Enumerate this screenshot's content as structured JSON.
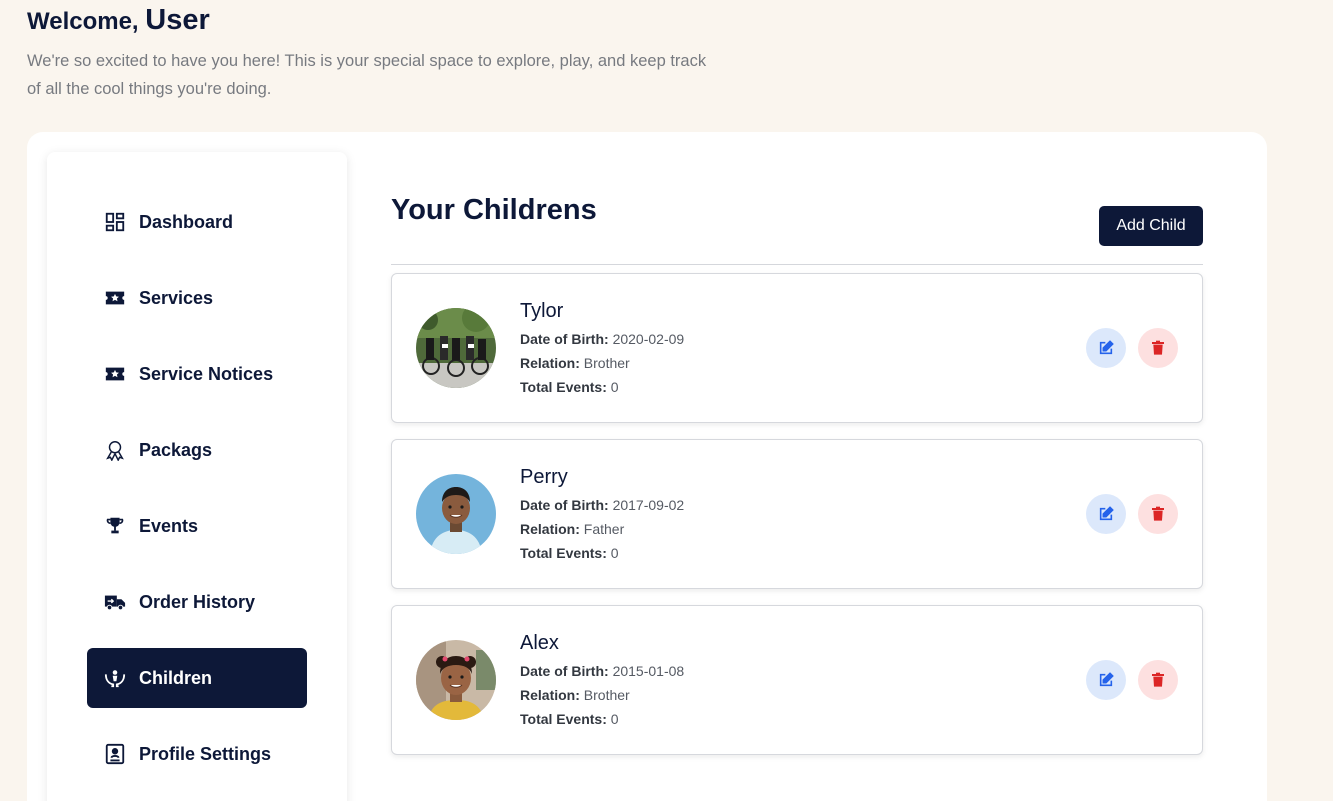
{
  "header": {
    "welcome_prefix": "Welcome,",
    "user_name": "User",
    "intro_text": "We're so excited to have you here! This is your special space to explore, play, and keep track of all the cool things you're doing."
  },
  "sidebar": {
    "items": [
      {
        "label": "Dashboard",
        "icon": "dashboard-icon",
        "active": false
      },
      {
        "label": "Services",
        "icon": "ticket-star-icon",
        "active": false
      },
      {
        "label": "Service Notices",
        "icon": "ticket-star-icon",
        "active": false
      },
      {
        "label": "Packags",
        "icon": "award-ribbon-icon",
        "active": false
      },
      {
        "label": "Events",
        "icon": "trophy-icon",
        "active": false
      },
      {
        "label": "Order History",
        "icon": "delivery-truck-icon",
        "active": false
      },
      {
        "label": "Children",
        "icon": "hands-child-icon",
        "active": true
      },
      {
        "label": "Profile Settings",
        "icon": "profile-card-icon",
        "active": false
      }
    ]
  },
  "main": {
    "title": "Your Childrens",
    "add_button_label": "Add Child",
    "field_labels": {
      "dob": "Date of Birth:",
      "relation": "Relation:",
      "events": "Total Events:"
    },
    "children": [
      {
        "name": "Tylor",
        "dob": "2020-02-09",
        "relation": "Brother",
        "total_events": "0"
      },
      {
        "name": "Perry",
        "dob": "2017-09-02",
        "relation": "Father",
        "total_events": "0"
      },
      {
        "name": "Alex",
        "dob": "2015-01-08",
        "relation": "Brother",
        "total_events": "0"
      }
    ]
  },
  "colors": {
    "navy": "#0d1838",
    "background": "#faf5ee",
    "edit_bg": "#dce8fb",
    "edit_icon": "#2563eb",
    "delete_bg": "#fde0e0",
    "delete_icon": "#dc2626"
  }
}
